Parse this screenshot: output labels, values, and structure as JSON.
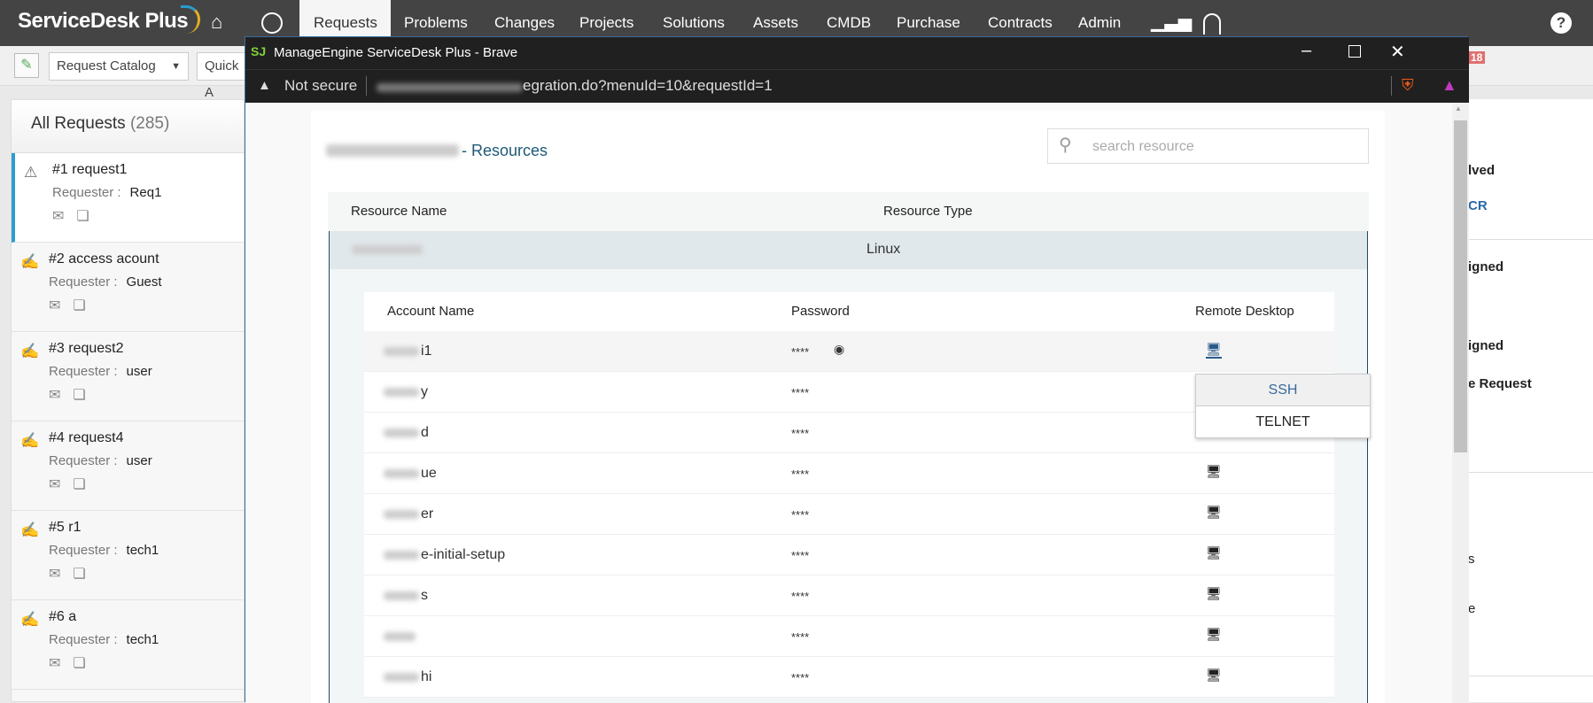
{
  "app": {
    "logo": "ServiceDesk Plus",
    "nav": [
      "Requests",
      "Problems",
      "Changes",
      "Projects",
      "Solutions",
      "Assets",
      "CMDB",
      "Purchase",
      "Contracts",
      "Admin"
    ],
    "active_nav": "Requests",
    "help": "?"
  },
  "toolbar": {
    "catalog": "Request Catalog",
    "quick": "Quick A",
    "badge": "18"
  },
  "list": {
    "title": "All Requests",
    "count": "(285)",
    "requester_label": "Requester :",
    "items": [
      {
        "title": "#1 request1",
        "requester": "Req1"
      },
      {
        "title": "#2 access acount",
        "requester": "Guest"
      },
      {
        "title": "#3 request2",
        "requester": "user"
      },
      {
        "title": "#4 request4",
        "requester": "user"
      },
      {
        "title": "#5 r1",
        "requester": "tech1"
      },
      {
        "title": "#6 a",
        "requester": "tech1"
      }
    ]
  },
  "right": {
    "t1": "lved",
    "t2": "CR",
    "t3": "igned",
    "t4": "igned",
    "t5": "e Request",
    "t6": "s",
    "t7": "e"
  },
  "popup": {
    "window_title": "ManageEngine ServiceDesk Plus - Brave",
    "not_secure": "Not secure",
    "url": "egration.do?menuId=10&requestId=1",
    "heading": "- Resources",
    "search_placeholder": "search resource",
    "resource_cols": [
      "Resource Name",
      "Resource Type"
    ],
    "resource": {
      "type": "Linux"
    },
    "account_cols": [
      "Account Name",
      "Password",
      "Remote Desktop"
    ],
    "accounts": [
      {
        "name": "i1",
        "password": "****"
      },
      {
        "name": "y",
        "password": "****"
      },
      {
        "name": "d",
        "password": "****"
      },
      {
        "name": "ue",
        "password": "****"
      },
      {
        "name": "er",
        "password": "****"
      },
      {
        "name": "e-initial-setup",
        "password": "****"
      },
      {
        "name": "s",
        "password": "****"
      },
      {
        "name": "",
        "password": "****"
      },
      {
        "name": "hi",
        "password": "****"
      }
    ],
    "menu": [
      "SSH",
      "TELNET"
    ]
  },
  "colors": {
    "accent": "#2c9ccf",
    "heading": "#1e5a78",
    "nav": "#444444"
  }
}
